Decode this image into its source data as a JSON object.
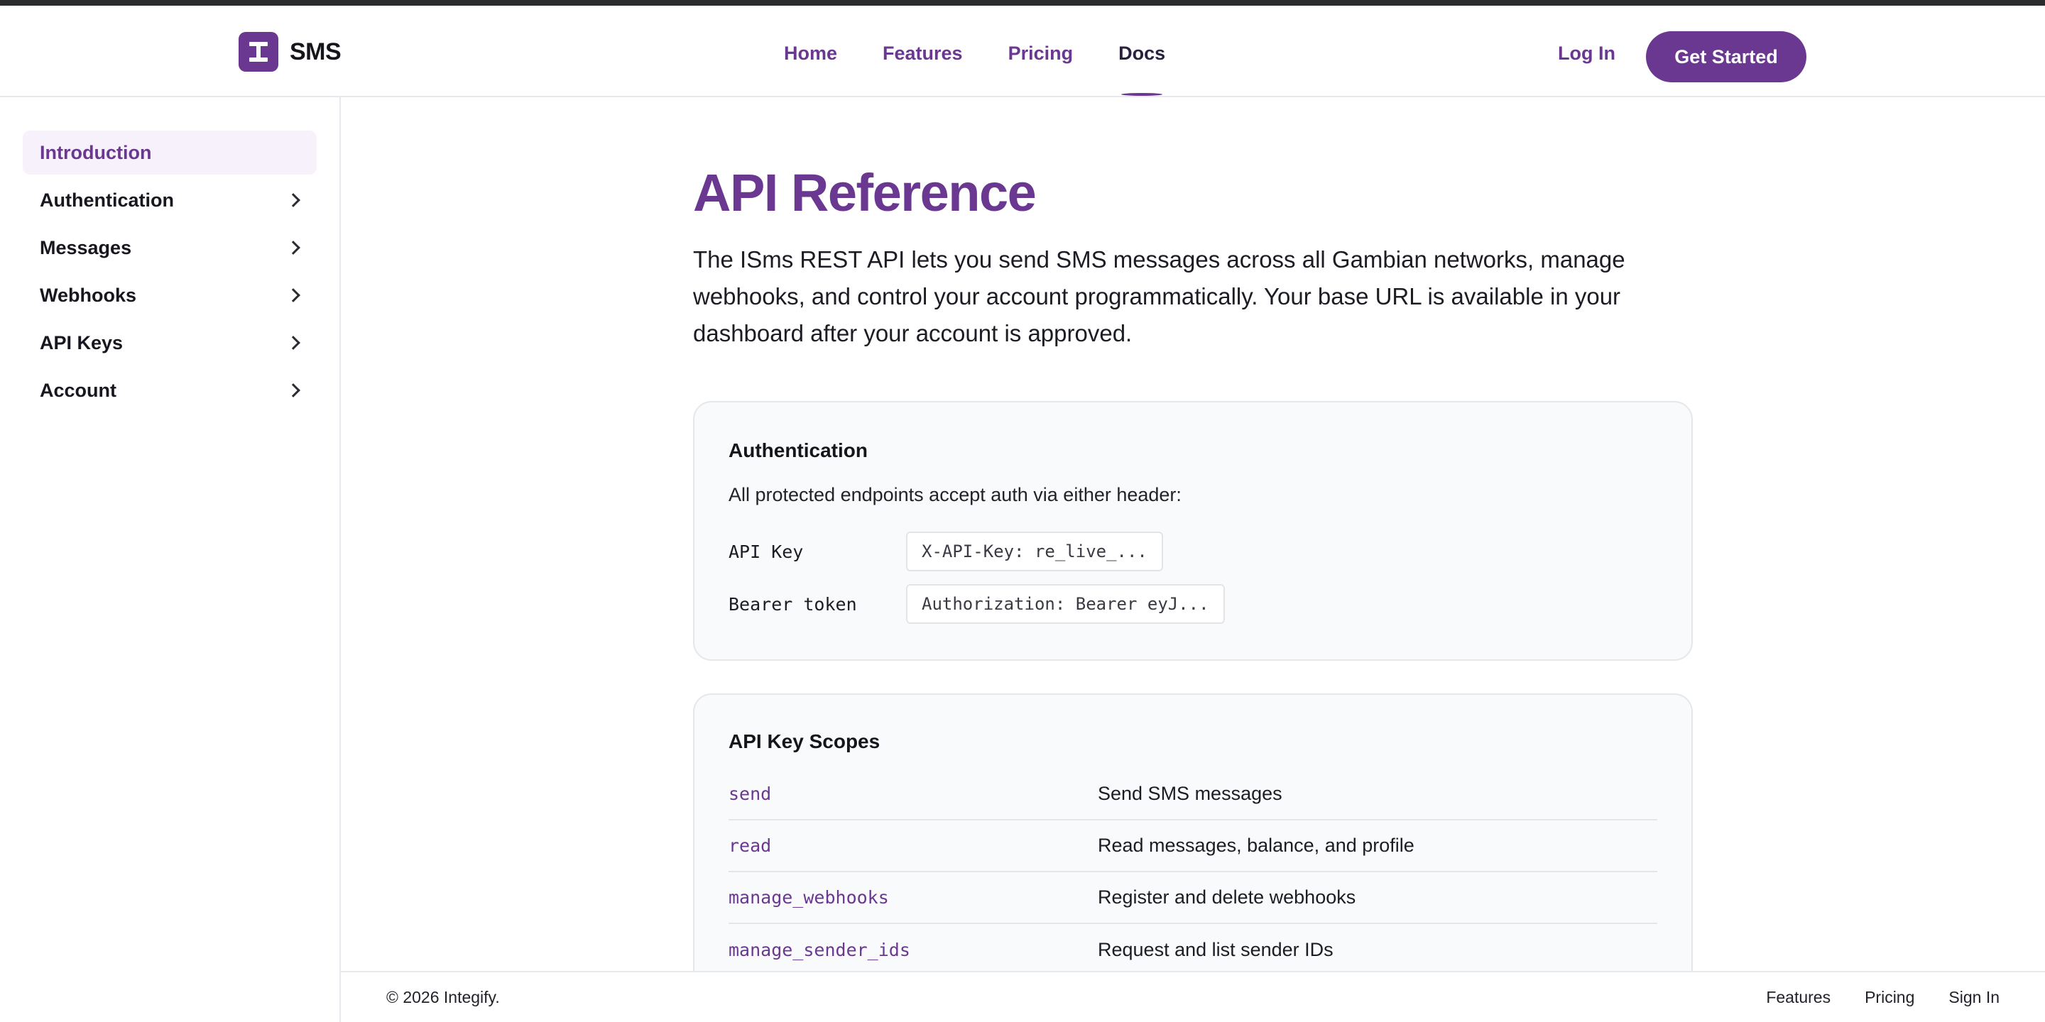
{
  "brand": {
    "name": "SMS",
    "logo_icon": "integify-i-logo",
    "accent_color": "#6a3791"
  },
  "nav": {
    "links": [
      {
        "label": "Home"
      },
      {
        "label": "Features"
      },
      {
        "label": "Pricing"
      },
      {
        "label": "Docs"
      }
    ],
    "active": "Docs",
    "login_label": "Log In",
    "cta_label": "Get Started"
  },
  "sidebar": {
    "items": [
      {
        "label": "Introduction",
        "active": true
      },
      {
        "label": "Authentication",
        "icon": "chevron-right-icon"
      },
      {
        "label": "Messages",
        "icon": "chevron-right-icon"
      },
      {
        "label": "Webhooks",
        "icon": "chevron-right-icon"
      },
      {
        "label": "API Keys",
        "icon": "chevron-right-icon"
      },
      {
        "label": "Account",
        "icon": "chevron-right-icon"
      }
    ]
  },
  "main": {
    "title": "API Reference",
    "intro": "The ISms REST API lets you send SMS messages across all Gambian networks, manage webhooks, and control your account programmatically. Your base URL is available in your dashboard after your account is approved.",
    "auth_card": {
      "title": "Authentication",
      "description": "All protected endpoints accept auth via either header:",
      "rows": [
        {
          "label": "API Key",
          "value": "X-API-Key: re_live_..."
        },
        {
          "label": "Bearer token",
          "value": "Authorization: Bearer eyJ..."
        }
      ]
    },
    "scopes_card": {
      "title": "API Key Scopes",
      "rows": [
        {
          "scope": "send",
          "description": "Send SMS messages"
        },
        {
          "scope": "read",
          "description": "Read messages, balance, and profile"
        },
        {
          "scope": "manage_webhooks",
          "description": "Register and delete webhooks"
        },
        {
          "scope": "manage_sender_ids",
          "description": "Request and list sender IDs"
        }
      ]
    }
  },
  "footer": {
    "copyright": "© 2026 Integify.",
    "links": [
      {
        "label": "Features"
      },
      {
        "label": "Pricing"
      },
      {
        "label": "Sign In"
      }
    ]
  }
}
